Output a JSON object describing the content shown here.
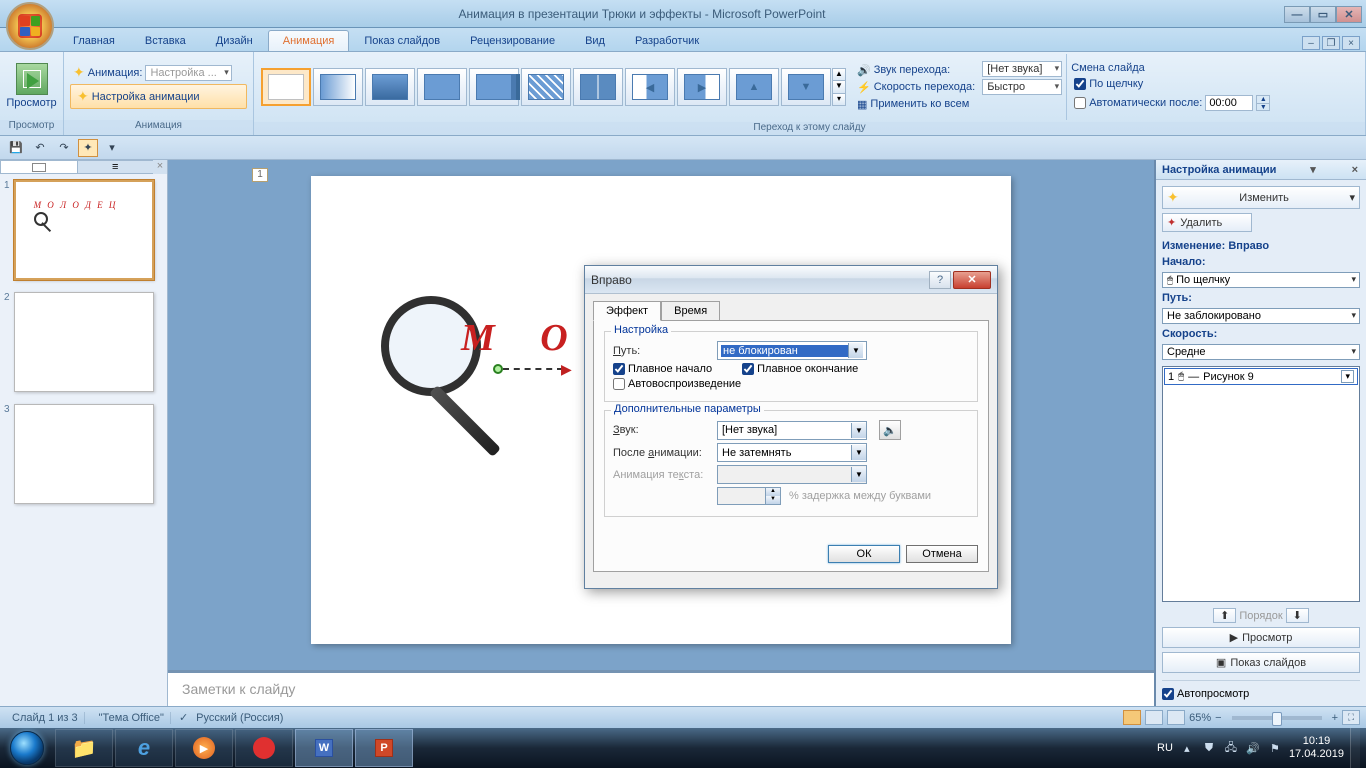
{
  "titlebar": {
    "title": "Анимация в презентации Трюки и эффекты - Microsoft PowerPoint"
  },
  "tabs": {
    "items": [
      "Главная",
      "Вставка",
      "Дизайн",
      "Анимация",
      "Показ слайдов",
      "Рецензирование",
      "Вид",
      "Разработчик"
    ],
    "active_index": 3
  },
  "ribbon": {
    "preview_btn": "Просмотр",
    "groups": {
      "preview": "Просмотр",
      "animation": "Анимация",
      "transition": "Переход к этому слайду"
    },
    "anim_label": "Анимация:",
    "anim_value": "Настройка ...",
    "custom_anim_btn": "Настройка анимации",
    "sound_label": "Звук перехода:",
    "sound_value": "[Нет звука]",
    "speed_label": "Скорость перехода:",
    "speed_value": "Быстро",
    "apply_all": "Применить ко всем",
    "advance_title": "Смена слайда",
    "on_click": "По щелчку",
    "auto_after": "Автоматически после:",
    "auto_time": "00:00"
  },
  "thumbnails": {
    "slides": [
      1,
      2,
      3
    ],
    "active": 1,
    "slide1_text": "М О Л О Д Е Ц"
  },
  "slide": {
    "placeholder_num": "1",
    "big_text": "М  О  Л",
    "notes_placeholder": "Заметки к слайду"
  },
  "anim_panel": {
    "title": "Настройка анимации",
    "change_btn": "Изменить",
    "remove_btn": "Удалить",
    "section_change": "Изменение: Вправо",
    "start_label": "Начало:",
    "start_value": "По щелчку",
    "path_label": "Путь:",
    "path_value": "Не заблокировано",
    "speed_label": "Скорость:",
    "speed_value": "Средне",
    "item1_num": "1",
    "item1_name": "Рисунок 9",
    "reorder": "Порядок",
    "play_btn": "Просмотр",
    "slideshow_btn": "Показ слайдов",
    "autopreview": "Автопросмотр"
  },
  "dialog": {
    "title": "Вправо",
    "tabs": [
      "Эффект",
      "Время"
    ],
    "group_settings": "Настройка",
    "path_label": "Путь:",
    "path_value": "не блокирован",
    "smooth_start": "Плавное начало",
    "smooth_end": "Плавное окончание",
    "autorev": "Автовоспроизведение",
    "group_extra": "Дополнительные параметры",
    "sound_label": "Звук:",
    "sound_value": "[Нет звука]",
    "after_label": "После анимации:",
    "after_value": "Не затемнять",
    "animtext_label": "Анимация текста:",
    "delay_label": "% задержка между буквами",
    "ok": "ОК",
    "cancel": "Отмена"
  },
  "statusbar": {
    "slide_info": "Слайд 1 из 3",
    "theme": "\"Тема Office\"",
    "language": "Русский (Россия)",
    "zoom": "65%"
  },
  "taskbar": {
    "lang": "RU",
    "time": "10:19",
    "date": "17.04.2019"
  }
}
